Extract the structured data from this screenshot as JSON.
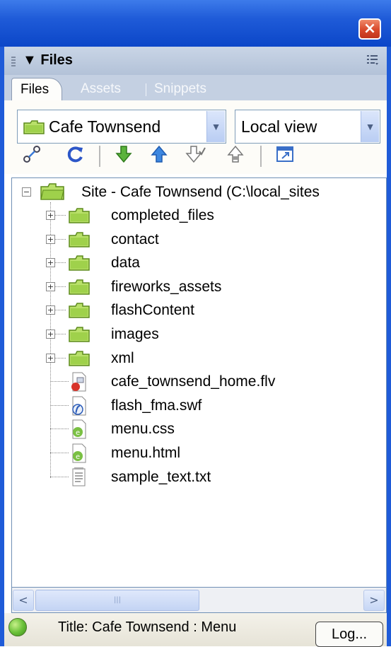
{
  "window": {
    "close_label": "×"
  },
  "panel": {
    "title": "▼ Files",
    "options_icon": "options-menu-icon"
  },
  "tabs": [
    {
      "label": "Files",
      "active": true
    },
    {
      "label": "Assets",
      "active": false
    },
    {
      "label": "Snippets",
      "active": false
    }
  ],
  "site_select": {
    "value": "Cafe Townsend"
  },
  "view_select": {
    "value": "Local view"
  },
  "toolbar": {
    "icons": [
      "connect-icon",
      "refresh-icon",
      "get-icon",
      "put-icon",
      "check-out-icon",
      "check-in-icon",
      "expand-icon"
    ]
  },
  "tree": {
    "root": "Site - Cafe Townsend (C:\\local_sites",
    "folders": [
      "completed_files",
      "contact",
      "data",
      "fireworks_assets",
      "flashContent",
      "images",
      "xml"
    ],
    "files": [
      {
        "name": "cafe_townsend_home.flv",
        "icon": "flv-file-icon"
      },
      {
        "name": "flash_fma.swf",
        "icon": "swf-file-icon"
      },
      {
        "name": "menu.css",
        "icon": "css-file-icon"
      },
      {
        "name": "menu.html",
        "icon": "html-file-icon"
      },
      {
        "name": "sample_text.txt",
        "icon": "txt-file-icon"
      }
    ]
  },
  "scrollbar": {
    "left": "<",
    "right": ">",
    "grip": "|||"
  },
  "status": {
    "text": "Title: Cafe Townsend : Menu",
    "log_label": "Log..."
  },
  "colors": {
    "titlebar": "#1f5bd8",
    "folder": "#9fd14b",
    "panel_header": "#c9d5e6"
  }
}
